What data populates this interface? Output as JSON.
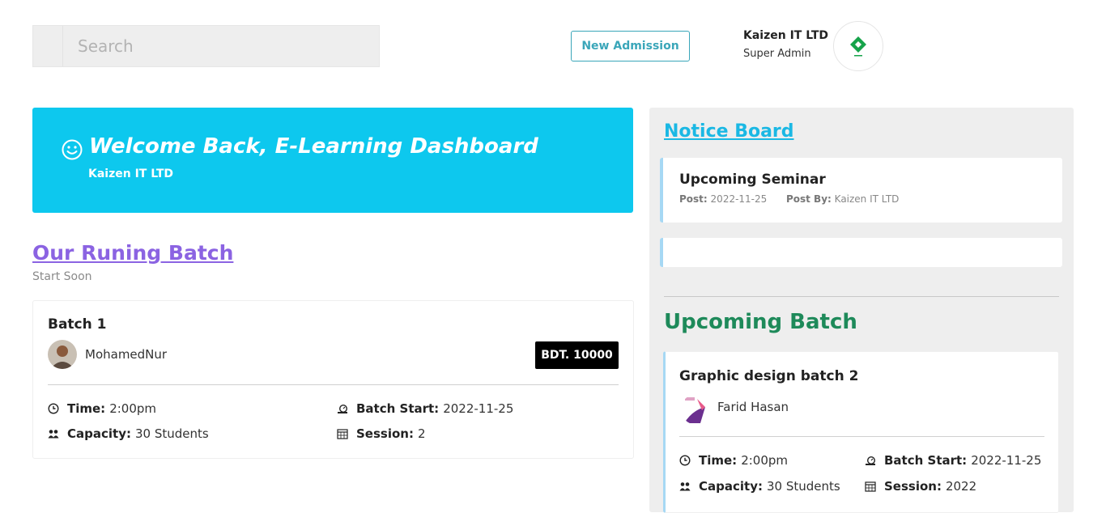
{
  "header": {
    "search_placeholder": "Search",
    "new_admission_label": "New Admission",
    "profile": {
      "name": "Kaizen IT LTD",
      "role": "Super Admin"
    }
  },
  "welcome": {
    "title": "Welcome Back, E-Learning Dashboard",
    "subtitle": "Kaizen IT LTD"
  },
  "running_batch": {
    "title": "Our Runing Batch",
    "subtitle": "Start Soon",
    "batch": {
      "name": "Batch 1",
      "trainer": "MohamedNur",
      "price": "BDT. 10000",
      "time_label": "Time:",
      "time": "2:00pm",
      "start_label": "Batch Start:",
      "start": "2022-11-25",
      "capacity_label": "Capacity:",
      "capacity": "30 Students",
      "session_label": "Session:",
      "session": "2"
    }
  },
  "notice_board": {
    "title": "Notice Board",
    "items": [
      {
        "title": "Upcoming Seminar",
        "post_label": "Post:",
        "post_date": "2022-11-25",
        "post_by_label": "Post By:",
        "post_by": "Kaizen IT LTD"
      }
    ]
  },
  "upcoming_batch": {
    "title": "Upcoming Batch",
    "batch": {
      "name": "Graphic design batch 2",
      "trainer": "Farid Hasan",
      "time_label": "Time:",
      "time": "2:00pm",
      "start_label": "Batch Start:",
      "start": "2022-11-25",
      "capacity_label": "Capacity:",
      "capacity": "30 Students",
      "session_label": "Session:",
      "session": "2022"
    }
  },
  "icons": {
    "time": "clock-icon",
    "batch_start": "start-icon",
    "capacity": "students-icon",
    "session": "calendar-icon",
    "welcome": "smile-icon",
    "logo": "diamond-logo"
  },
  "colors": {
    "welcome_bg": "#0dc8ee",
    "running_title": "#8b63e2",
    "notice_title": "#1ab8e4",
    "upcoming_title": "#1e8a5a",
    "admission_button": "#3aa6b9"
  }
}
